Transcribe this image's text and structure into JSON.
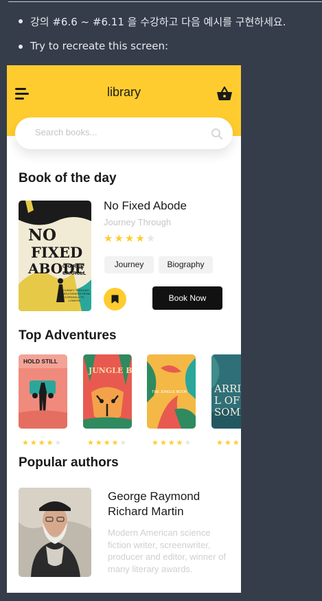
{
  "instructions": {
    "item1": "강의 #6.6 ~ #6.11 을 수강하고 다음 예시를 구현하세요.",
    "item2": "Try to recreate this screen:"
  },
  "app": {
    "title": "library",
    "menu_icon": "hamburger-menu-icon",
    "basket_icon": "shopping-basket-icon",
    "accent_color": "#ffcc2f"
  },
  "search": {
    "placeholder": "Search books...",
    "value": "",
    "icon": "search-icon"
  },
  "book_of_the_day": {
    "section_title": "Book of the day",
    "book": {
      "title": "No Fixed Abode",
      "subtitle": "Journey Through",
      "rating": 4,
      "rating_max": 5,
      "tags": [
        "Journey",
        "Biography"
      ],
      "bookmark_icon": "bookmark-icon",
      "cta_label": "Book Now",
      "cover": {
        "title_lines": [
          "NO",
          "FIXED",
          "ABODE"
        ],
        "author_lines": [
          "CHARLIE",
          "CARROLL"
        ],
        "tagline": "A JOURNEY THROUGH HOMELESSNESS FROM CORNWALL TO LONDON"
      }
    }
  },
  "top_adventures": {
    "section_title": "Top Adventures",
    "books": [
      {
        "cover_text": "HOLD STILL",
        "rating": 4,
        "bg": "#f08a7c"
      },
      {
        "cover_text": "JUNGLE BOOK",
        "rating": 4,
        "bg": "#e85a4f"
      },
      {
        "cover_text": "THE JUNGLE BOOK",
        "rating": 4,
        "bg": "#f3b845"
      },
      {
        "cover_text": "ARRIVAL OF SOME",
        "rating": 4,
        "bg": "#2f6f78"
      }
    ]
  },
  "popular_authors": {
    "section_title": "Popular authors",
    "author": {
      "name": "George Raymond Richard Martin",
      "bio": "Modern American science fiction writer, screenwriter, producer and editor, winner of many literary awards."
    }
  }
}
